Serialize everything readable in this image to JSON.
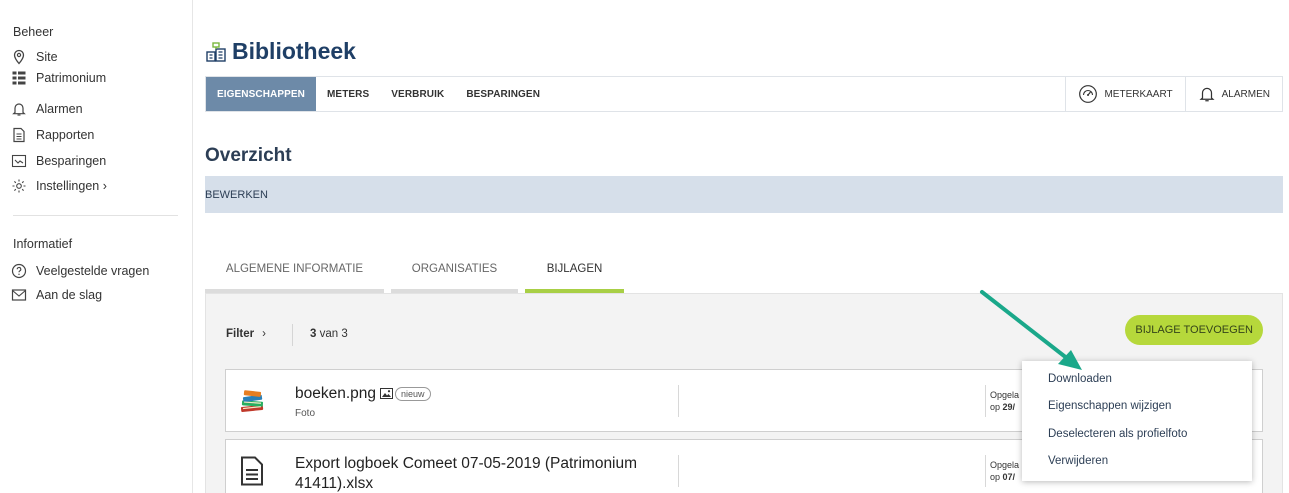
{
  "sidebar": {
    "sections": [
      {
        "heading": "Beheer",
        "items": [
          {
            "label": "Site",
            "icon": "location-pin-icon"
          },
          {
            "label": "Patrimonium",
            "icon": "grid-list-icon"
          },
          {
            "label": "Alarmen",
            "icon": "bell-icon"
          },
          {
            "label": "Rapporten",
            "icon": "document-icon"
          },
          {
            "label": "Besparingen",
            "icon": "savings-chart-icon"
          },
          {
            "label": "Instellingen ›",
            "icon": "gear-icon"
          }
        ]
      },
      {
        "heading": "Informatief",
        "items": [
          {
            "label": "Veelgestelde vragen",
            "icon": "question-circle-icon"
          },
          {
            "label": "Aan de slag",
            "icon": "envelope-icon"
          }
        ]
      }
    ]
  },
  "page": {
    "title": "Bibliotheek",
    "title_icon": "building-icon"
  },
  "topnav": {
    "tabs": [
      "EIGENSCHAPPEN",
      "METERS",
      "VERBRUIK",
      "BESPARINGEN"
    ],
    "active_tab": "EIGENSCHAPPEN",
    "actions": [
      {
        "label": "METERKAART",
        "icon": "gauge-icon"
      },
      {
        "label": "ALARMEN",
        "icon": "bell-icon"
      }
    ]
  },
  "overview": {
    "title": "Overzicht",
    "edit_label": "BEWERKEN"
  },
  "subtabs": {
    "items": [
      "ALGEMENE INFORMATIE",
      "ORGANISATIES",
      "BIJLAGEN"
    ],
    "active": "BIJLAGEN"
  },
  "attachments": {
    "filter_label": "Filter",
    "filter_chevron": "›",
    "count_shown": "3",
    "count_suffix": "van 3",
    "add_button": "BIJLAGE TOEVOEGEN",
    "files": [
      {
        "name": "boeken.png",
        "type": "Foto",
        "badge": "nieuw",
        "uploaded_label": "Opgela",
        "uploaded_on_prefix": "op",
        "uploaded_on_value": "29/"
      },
      {
        "name": "Export logboek Comeet 07-05-2019 (Patrimonium 41411).xlsx",
        "type": "",
        "uploaded_label": "Opgela",
        "uploaded_on_prefix": "op",
        "uploaded_on_value": "07/"
      }
    ]
  },
  "context_menu": {
    "items": [
      "Downloaden",
      "Eigenschappen wijzigen",
      "Deselecteren als profielfoto",
      "Verwijderen"
    ]
  },
  "colors": {
    "active_tab_bg": "#6d8aa8",
    "accent_green": "#b6d83b",
    "subtab_active": "#a8cf45",
    "edit_bar_bg": "#d6dfea",
    "title_blue": "#1f3f66",
    "arrow_teal": "#1aa88a"
  }
}
